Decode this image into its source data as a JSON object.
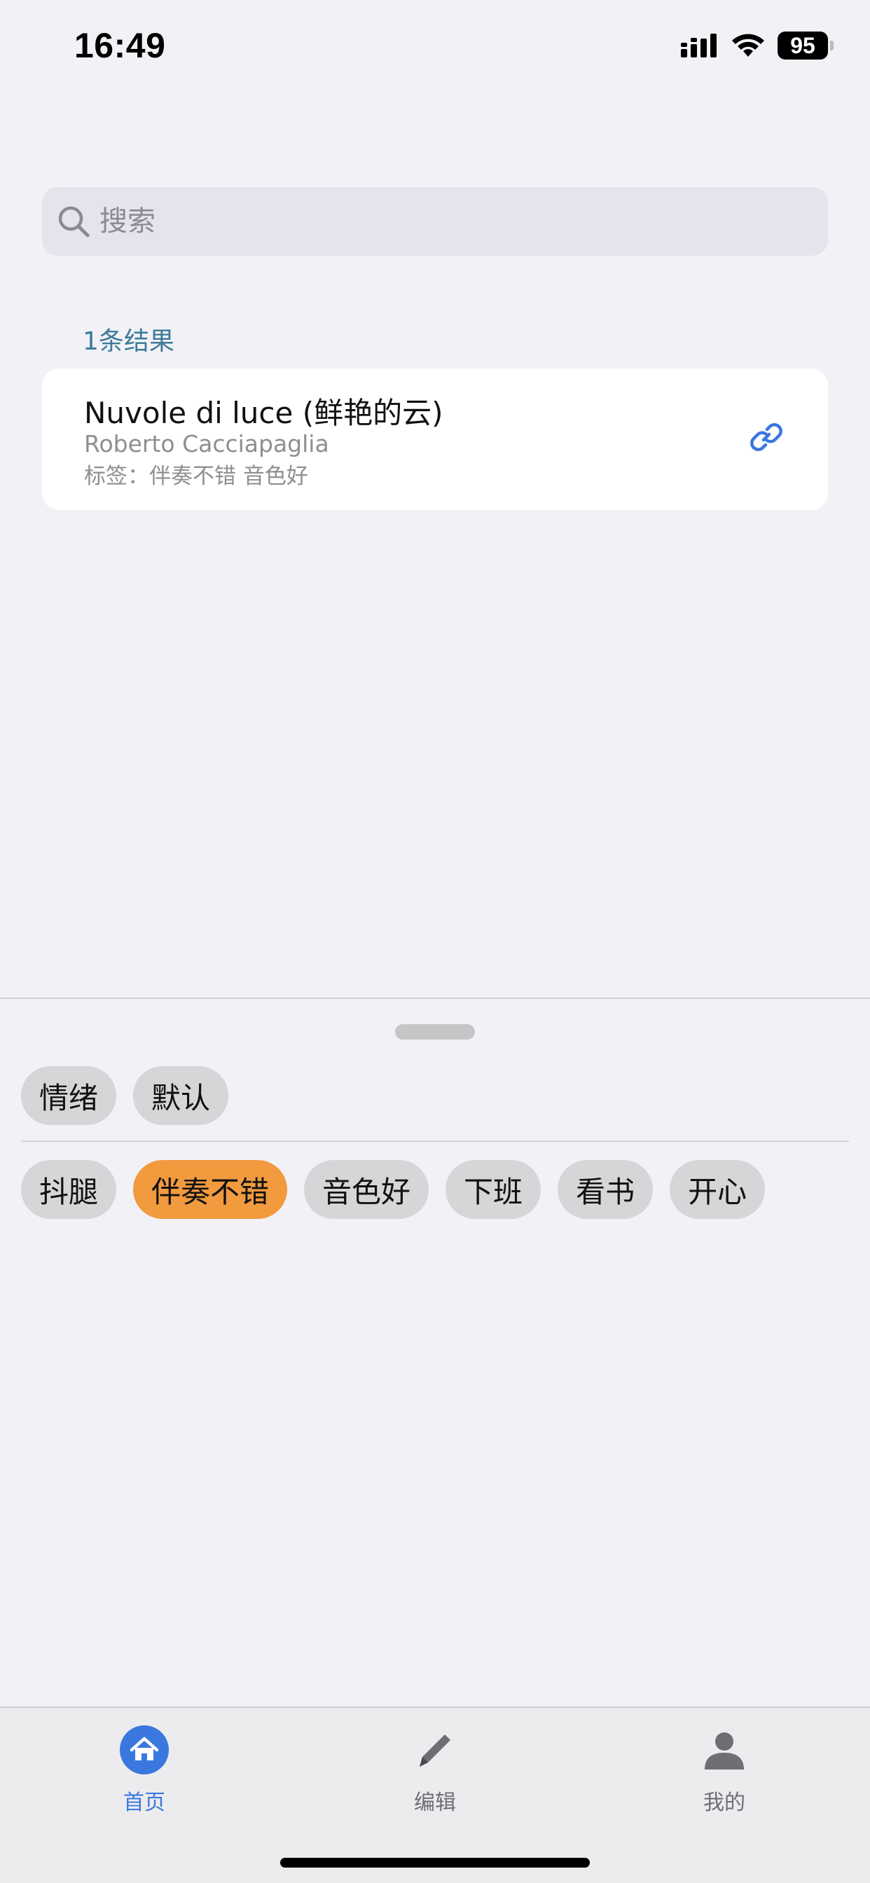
{
  "status_bar": {
    "time": "16:49",
    "battery": "95"
  },
  "search": {
    "placeholder": "搜索",
    "value": ""
  },
  "results": {
    "count_label": "1条结果",
    "items": [
      {
        "title": "Nuvole di luce (鲜艳的云)",
        "artist": "Roberto Cacciapaglia",
        "tags_label": "标签：伴奏不错 音色好",
        "icon": "link-icon"
      }
    ]
  },
  "categories": [
    "情绪",
    "默认"
  ],
  "tags": [
    {
      "label": "抖腿",
      "selected": false
    },
    {
      "label": "伴奏不错",
      "selected": true
    },
    {
      "label": "音色好",
      "selected": false
    },
    {
      "label": "下班",
      "selected": false
    },
    {
      "label": "看书",
      "selected": false
    },
    {
      "label": "开心",
      "selected": false
    }
  ],
  "tab_bar": {
    "items": [
      {
        "label": "首页",
        "icon": "home-icon",
        "active": true
      },
      {
        "label": "编辑",
        "icon": "pencil-icon",
        "active": false
      },
      {
        "label": "我的",
        "icon": "person-icon",
        "active": false
      }
    ]
  },
  "colors": {
    "accent": "#3a78e0",
    "selected_tag": "#f19a3e",
    "results_label": "#3d7a9a",
    "background": "#f2f2f6"
  }
}
